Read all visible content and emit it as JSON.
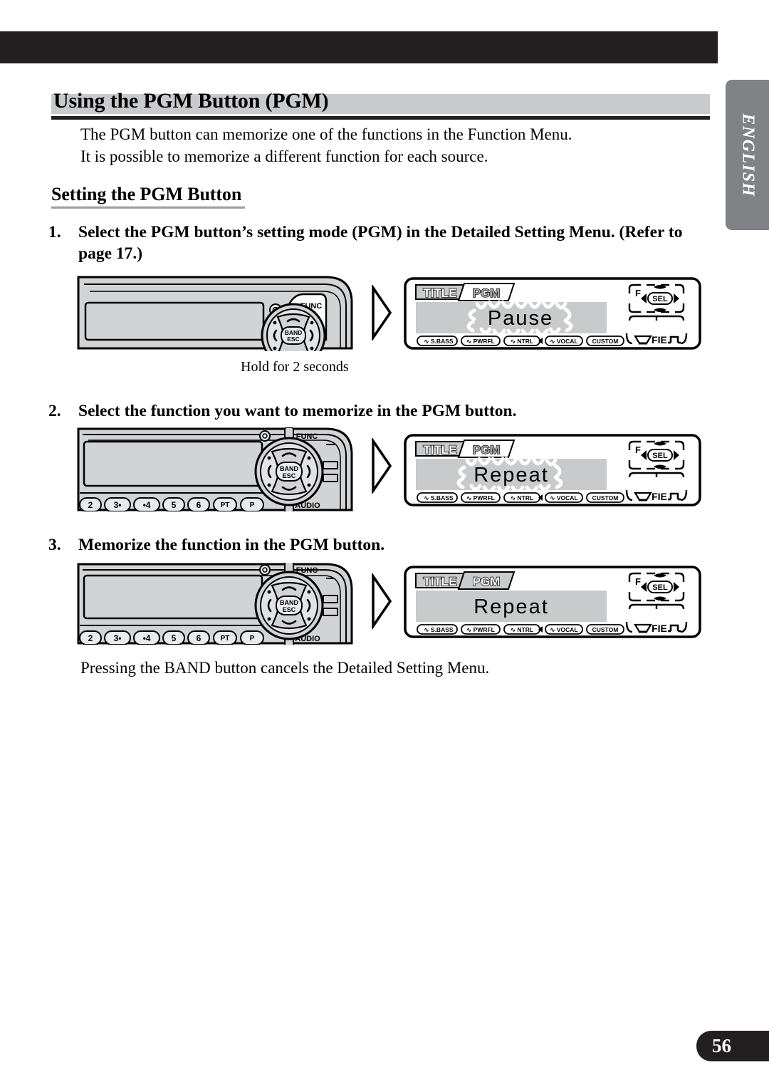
{
  "language_tab": {
    "label": "ENGLISH"
  },
  "heading": {
    "title": "Using the PGM Button (PGM)"
  },
  "intro": {
    "line1": "The PGM button can memorize one of the functions in the Function Menu.",
    "line2": "It is possible to memorize a different function for each source."
  },
  "subheading": {
    "title": "Setting the PGM Button"
  },
  "steps": [
    {
      "number": "1.",
      "text": "Select the PGM button’s setting mode (PGM) in the Detailed Setting Menu. (Refer to page 17.)",
      "caption": "Hold for 2 seconds"
    },
    {
      "number": "2.",
      "text": "Select the function you want to memorize in the PGM button.",
      "caption": ""
    },
    {
      "number": "3.",
      "text": "Memorize the function in the PGM button.",
      "caption": ""
    }
  ],
  "footer_note": {
    "text": "Pressing the BAND button cancels the Detailed Setting Menu."
  },
  "page_number": {
    "value": "56"
  },
  "unit_illustrations": [
    {
      "id": "unit-step-1",
      "knob_label": "BAND ESC",
      "func_label": "FUNC",
      "audio_label": "",
      "preset_buttons": []
    },
    {
      "id": "unit-step-2",
      "knob_label": "BAND ESC",
      "func_label": "FUNC",
      "audio_label": "AUDIO",
      "preset_buttons": [
        "2",
        "3•",
        "•4",
        "5",
        "6",
        "PT",
        "P"
      ]
    },
    {
      "id": "unit-step-3",
      "knob_label": "BAND ESC",
      "func_label": "FUNC",
      "audio_label": "AUDIO",
      "preset_buttons": [
        "2",
        "3•",
        "•4",
        "5",
        "6",
        "PT",
        "P"
      ]
    }
  ],
  "lcd_displays": [
    {
      "id": "lcd-step-1",
      "tab_title": "TITLE",
      "tab_pgm": "PGM",
      "main_text": "Pause",
      "blinking": true,
      "eq_indicators": [
        "S.BASS",
        "PWRFL",
        "NTRL",
        "VOCAL",
        "CUSTOM"
      ],
      "fader_label": "F",
      "sel_label": "SEL",
      "fie_label": "FIE"
    },
    {
      "id": "lcd-step-2",
      "tab_title": "TITLE",
      "tab_pgm": "PGM",
      "main_text": "Repeat",
      "blinking": true,
      "eq_indicators": [
        "S.BASS",
        "PWRFL",
        "NTRL",
        "VOCAL",
        "CUSTOM"
      ],
      "fader_label": "F",
      "sel_label": "SEL",
      "fie_label": "FIE"
    },
    {
      "id": "lcd-step-3",
      "tab_title": "TITLE",
      "tab_pgm": "PGM",
      "main_text": "Repeat",
      "blinking": false,
      "eq_indicators": [
        "S.BASS",
        "PWRFL",
        "NTRL",
        "VOCAL",
        "CUSTOM"
      ],
      "fader_label": "F",
      "sel_label": "SEL",
      "fie_label": "FIE"
    }
  ],
  "colors": {
    "black_bar": "#231f20",
    "heading_band": "#c9cacc",
    "side_tab": "#808285",
    "lcd_body": "#d2d3d5",
    "unit_body": "#d2d3d5"
  }
}
